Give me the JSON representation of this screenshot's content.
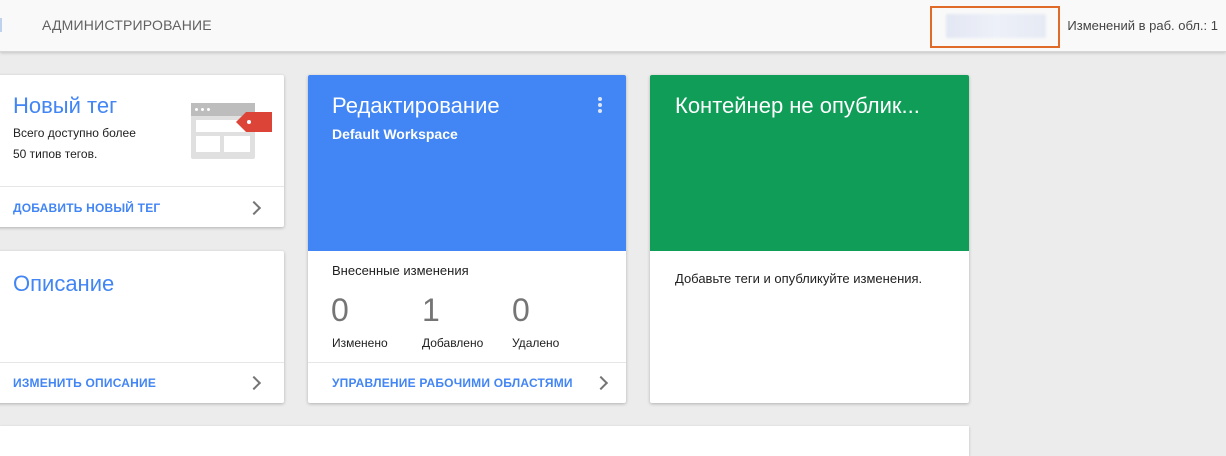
{
  "topbar": {
    "admin_tab": "АДМИНИСТРИРОВАНИЕ",
    "workspace_changes": "Изменений в раб. обл.: 1"
  },
  "new_tag_card": {
    "title": "Новый тег",
    "desc_line1": "Всего доступно более",
    "desc_line2": "50 типов тегов.",
    "link": "ДОБАВИТЬ НОВЫЙ ТЕГ",
    "illustration_icon": "tag-browser-illustration"
  },
  "description_card": {
    "title": "Описание",
    "link": "ИЗМЕНИТЬ ОПИСАНИЕ"
  },
  "workspace_card": {
    "title": "Редактирование",
    "subtitle": "Default Workspace",
    "changes_heading": "Внесенные изменения",
    "stats": [
      {
        "value": "0",
        "label": "Изменено"
      },
      {
        "value": "1",
        "label": "Добавлено"
      },
      {
        "value": "0",
        "label": "Удалено"
      }
    ],
    "link": "УПРАВЛЕНИЕ РАБОЧИМИ ОБЛАСТЯМИ"
  },
  "container_card": {
    "title": "Контейнер не опублик...",
    "body": "Добавьте теги и опубликуйте изменения."
  },
  "colors": {
    "accent_blue": "#4285f4",
    "publish_green": "#0f9d58",
    "tag_red": "#db4437",
    "highlight_orange": "#e06b28"
  }
}
